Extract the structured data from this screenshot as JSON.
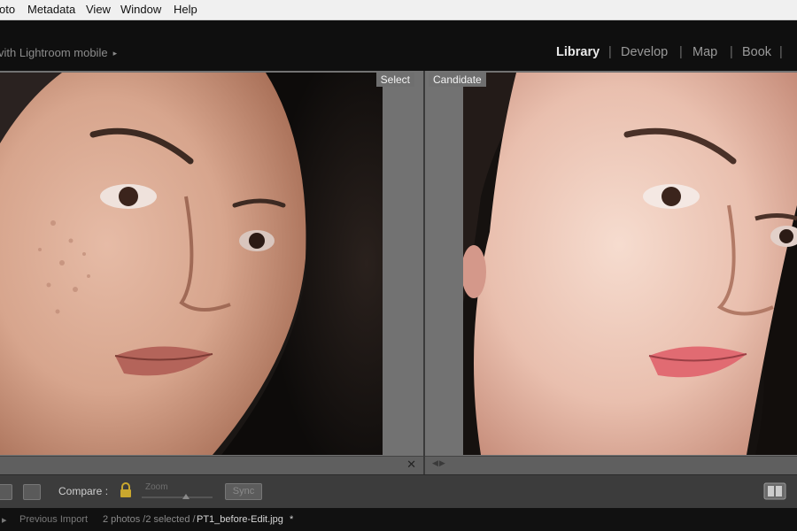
{
  "menu": [
    "oto",
    "Metadata",
    "View",
    "Window",
    "Help"
  ],
  "identity_plate": "vith Lightroom mobile",
  "modules": [
    {
      "label": "Library",
      "active": true
    },
    {
      "label": "Develop",
      "active": false
    },
    {
      "label": "Map",
      "active": false
    },
    {
      "label": "Book",
      "active": false
    }
  ],
  "compare": {
    "left_label": "Select",
    "right_label": "Candidate",
    "close_glyph": "✕"
  },
  "toolbar": {
    "compare_label": "Compare :",
    "zoom_label": "Zoom",
    "sync_label": "Sync"
  },
  "status": {
    "source": "Previous Import",
    "count": "2 photos /2 selected /",
    "filename": "PT1_before-Edit.jpg",
    "suffix": "*"
  },
  "colors": {
    "background": "#1b1b1b",
    "panel": "#727272",
    "active_module": "#e8e8e8"
  },
  "icons": [
    "triangle-right-icon",
    "lock-icon",
    "swap-arrows-icon",
    "close-icon",
    "view-mode-icon"
  ]
}
